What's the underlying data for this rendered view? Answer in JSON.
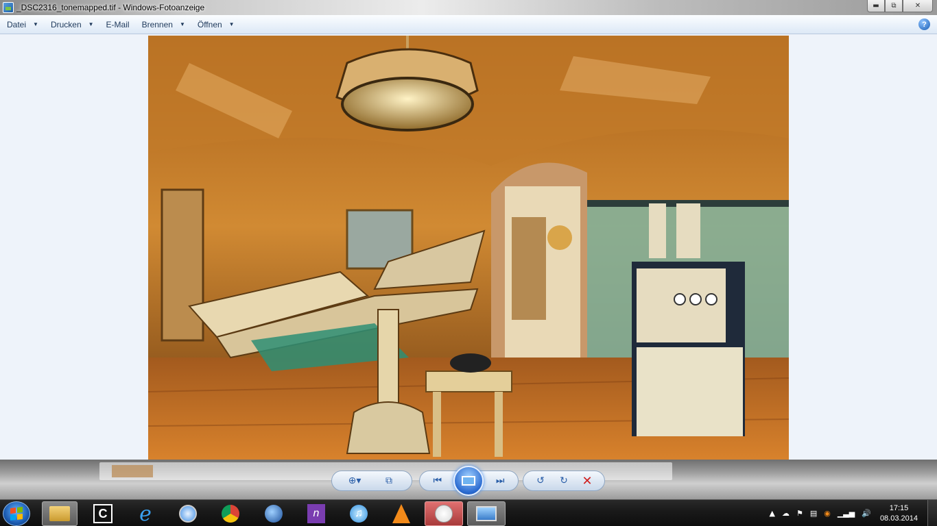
{
  "window": {
    "title": "_DSC2316_tonemapped.tif - Windows-Fotoanzeige",
    "minimize_icon": "minimize-icon",
    "maximize_icon": "restore-icon",
    "close_icon": "close-icon"
  },
  "menu": {
    "items": [
      {
        "label": "Datei",
        "has_dropdown": true
      },
      {
        "label": "Drucken",
        "has_dropdown": true
      },
      {
        "label": "E-Mail",
        "has_dropdown": false
      },
      {
        "label": "Brennen",
        "has_dropdown": true
      },
      {
        "label": "Öffnen",
        "has_dropdown": true
      }
    ],
    "help_label": "?"
  },
  "image": {
    "description_icon": "photo-hdr-abandoned-operating-room"
  },
  "controls": {
    "zoom": "zoom-icon",
    "fit": "actual-size-icon",
    "previous": "previous-icon",
    "slideshow": "slideshow-icon",
    "next": "next-icon",
    "rotate_left": "rotate-counterclockwise-icon",
    "rotate_right": "rotate-clockwise-icon",
    "delete": "delete-icon"
  },
  "taskbar": {
    "apps": [
      {
        "name": "file-explorer-icon",
        "active": true
      },
      {
        "name": "app-c-icon",
        "active": false
      },
      {
        "name": "internet-explorer-icon",
        "active": false
      },
      {
        "name": "safari-icon",
        "active": false
      },
      {
        "name": "chrome-icon",
        "active": false
      },
      {
        "name": "thunderbird-icon",
        "active": false
      },
      {
        "name": "onenote-icon",
        "active": false
      },
      {
        "name": "itunes-icon",
        "active": false
      },
      {
        "name": "vlc-icon",
        "active": false
      },
      {
        "name": "paint-icon",
        "active": true
      },
      {
        "name": "photo-viewer-icon",
        "active": true
      }
    ],
    "clock": {
      "time": "17:15",
      "date": "08.03.2014"
    }
  },
  "colors": {
    "menu_text": "#1e395b",
    "accent": "#2a6ad0",
    "delete": "#d01d1d"
  }
}
